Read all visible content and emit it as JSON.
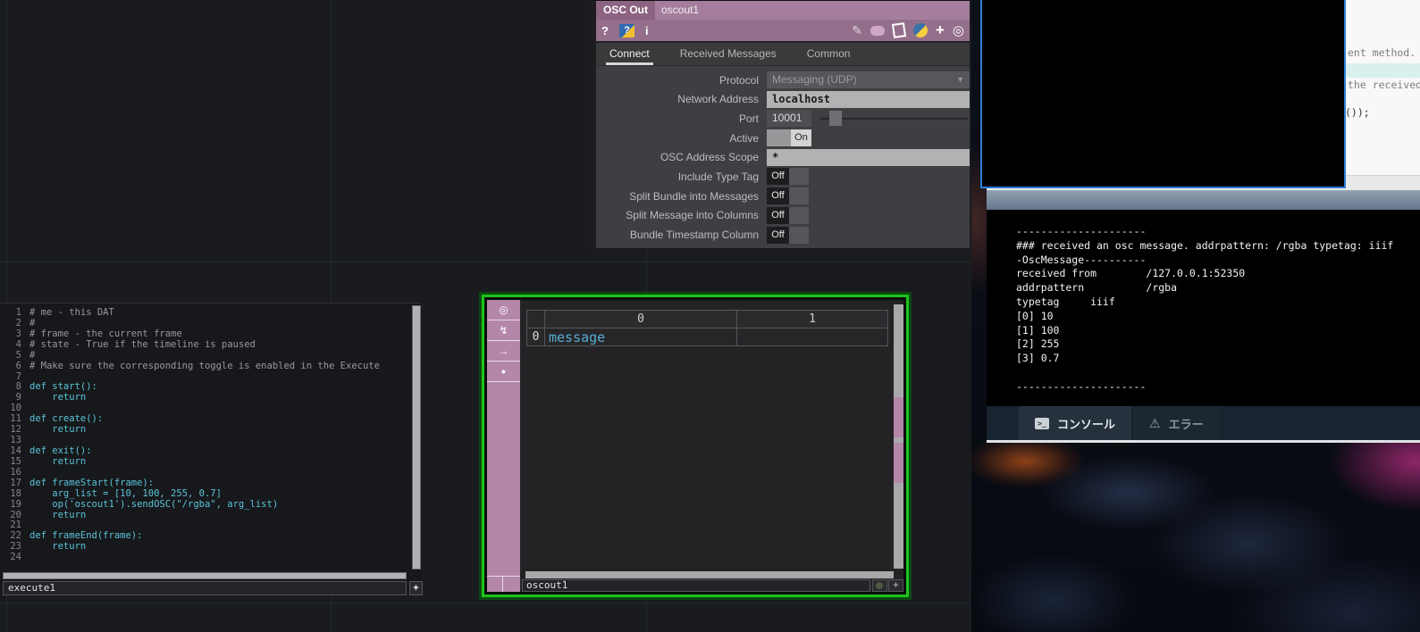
{
  "accent_colors": {
    "td_pink": "#b487a9",
    "td_mauve_header": "#946f8b",
    "selection_green": "#1cc41c",
    "sketch_border_blue": "#2d7ed8",
    "code_cyan": "#5ac4da",
    "cell_cyan": "#55aed4"
  },
  "param_dialog": {
    "op_type": "OSC Out",
    "op_name": "oscout1",
    "header_icons_left": {
      "help": "?",
      "python_help": "?",
      "info": "i"
    },
    "header_icons_right": {
      "pencil": "✎",
      "plus": "+",
      "target": "◎"
    },
    "tabs": [
      {
        "label": "Connect",
        "active": true
      },
      {
        "label": "Received Messages",
        "active": false
      },
      {
        "label": "Common",
        "active": false
      }
    ],
    "params": [
      {
        "label": "Protocol",
        "type": "dropdown",
        "value": "Messaging (UDP)"
      },
      {
        "label": "Network Address",
        "type": "text",
        "value": "localhost"
      },
      {
        "label": "Port",
        "type": "number_slider",
        "value": "10001"
      },
      {
        "label": "Active",
        "type": "toggle_on",
        "value": "On"
      },
      {
        "label": "OSC Address Scope",
        "type": "text",
        "value": "*"
      },
      {
        "label": "Include Type Tag",
        "type": "toggle_off",
        "value": "Off"
      },
      {
        "label": "Split Bundle into Messages",
        "type": "toggle_off",
        "value": "Off"
      },
      {
        "label": "Split Message into Columns",
        "type": "toggle_off",
        "value": "Off"
      },
      {
        "label": "Bundle Timestamp Column",
        "type": "toggle_off",
        "value": "Off"
      }
    ]
  },
  "code_editor": {
    "op_name": "execute1",
    "plus_label": "+",
    "lines": [
      {
        "n": "1",
        "text": "# me - this DAT",
        "comment": true
      },
      {
        "n": "2",
        "text": "#",
        "comment": true
      },
      {
        "n": "3",
        "text": "# frame - the current frame",
        "comment": true
      },
      {
        "n": "4",
        "text": "# state - True if the timeline is paused",
        "comment": true
      },
      {
        "n": "5",
        "text": "#",
        "comment": true
      },
      {
        "n": "6",
        "text": "# Make sure the corresponding toggle is enabled in the Execute",
        "comment": true
      },
      {
        "n": "7",
        "text": "",
        "comment": false
      },
      {
        "n": "8",
        "text": "def start():",
        "comment": false
      },
      {
        "n": "9",
        "text": "    return",
        "comment": false
      },
      {
        "n": "10",
        "text": "",
        "comment": false
      },
      {
        "n": "11",
        "text": "def create():",
        "comment": false
      },
      {
        "n": "12",
        "text": "    return",
        "comment": false
      },
      {
        "n": "13",
        "text": "",
        "comment": false
      },
      {
        "n": "14",
        "text": "def exit():",
        "comment": false
      },
      {
        "n": "15",
        "text": "    return",
        "comment": false
      },
      {
        "n": "16",
        "text": "",
        "comment": false
      },
      {
        "n": "17",
        "text": "def frameStart(frame):",
        "comment": false
      },
      {
        "n": "18",
        "text": "    arg_list = [10, 100, 255, 0.7]",
        "comment": false
      },
      {
        "n": "19",
        "text": "    op('oscout1').sendOSC(\"/rgba\", arg_list)",
        "comment": false
      },
      {
        "n": "20",
        "text": "    return",
        "comment": false
      },
      {
        "n": "21",
        "text": "",
        "comment": false
      },
      {
        "n": "22",
        "text": "def frameEnd(frame):",
        "comment": false
      },
      {
        "n": "23",
        "text": "    return",
        "comment": false
      },
      {
        "n": "24",
        "text": "",
        "comment": false
      }
    ]
  },
  "table_viewer": {
    "op_name": "oscout1",
    "plus_label": "+",
    "toolbar_icons": [
      "◎",
      "↯",
      "→",
      "●"
    ],
    "columns": [
      "0",
      "1"
    ],
    "rows": [
      {
        "header": "0",
        "cells": [
          "message",
          ""
        ]
      }
    ]
  },
  "processing": {
    "editor": {
      "fragments": [
        "ent method.",
        "the received",
        "());"
      ]
    },
    "console": {
      "lines": [
        "---------------------",
        "### received an osc message. addrpattern: /rgba typetag: iiif",
        "-OscMessage----------",
        "received from        /127.0.0.1:52350",
        "addrpattern          /rgba",
        "typetag     iiif",
        "[0] 10",
        "[1] 100",
        "[2] 255",
        "[3] 0.7",
        "",
        "---------------------"
      ]
    },
    "tabs": [
      {
        "label": "コンソール",
        "icon": "terminal",
        "active": true
      },
      {
        "label": "エラー",
        "icon": "warning",
        "active": false
      }
    ],
    "terminal_icon_glyph": ">_",
    "warning_icon_glyph": "⚠"
  }
}
